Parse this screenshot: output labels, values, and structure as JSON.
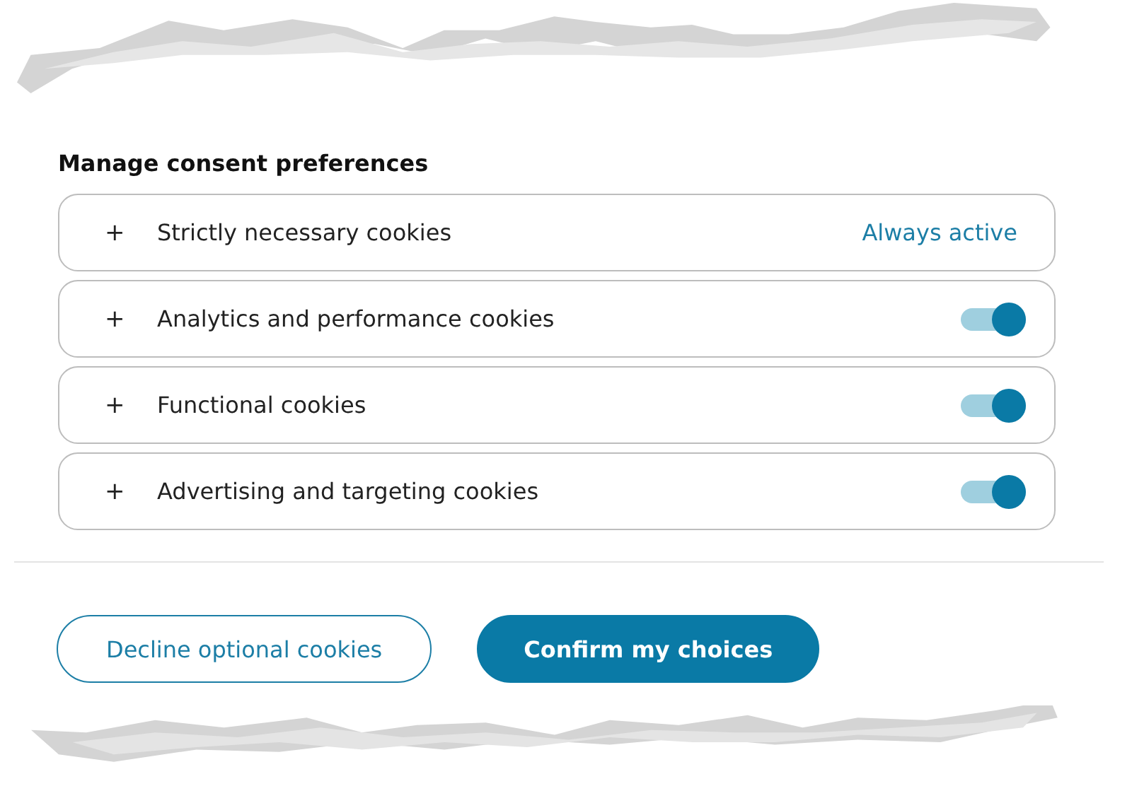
{
  "heading": "Manage consent preferences",
  "categories": [
    {
      "expand_icon": "+",
      "label": "Strictly necessary cookies",
      "kind": "always",
      "status": "Always active"
    },
    {
      "expand_icon": "+",
      "label": "Analytics and performance cookies",
      "kind": "toggle",
      "on": true
    },
    {
      "expand_icon": "+",
      "label": "Functional cookies",
      "kind": "toggle",
      "on": true
    },
    {
      "expand_icon": "+",
      "label": "Advertising and targeting cookies",
      "kind": "toggle",
      "on": true
    }
  ],
  "buttons": [
    {
      "label": "Decline optional cookies",
      "kind": "secondary"
    },
    {
      "label": "Confirm my choices",
      "kind": "primary"
    }
  ]
}
